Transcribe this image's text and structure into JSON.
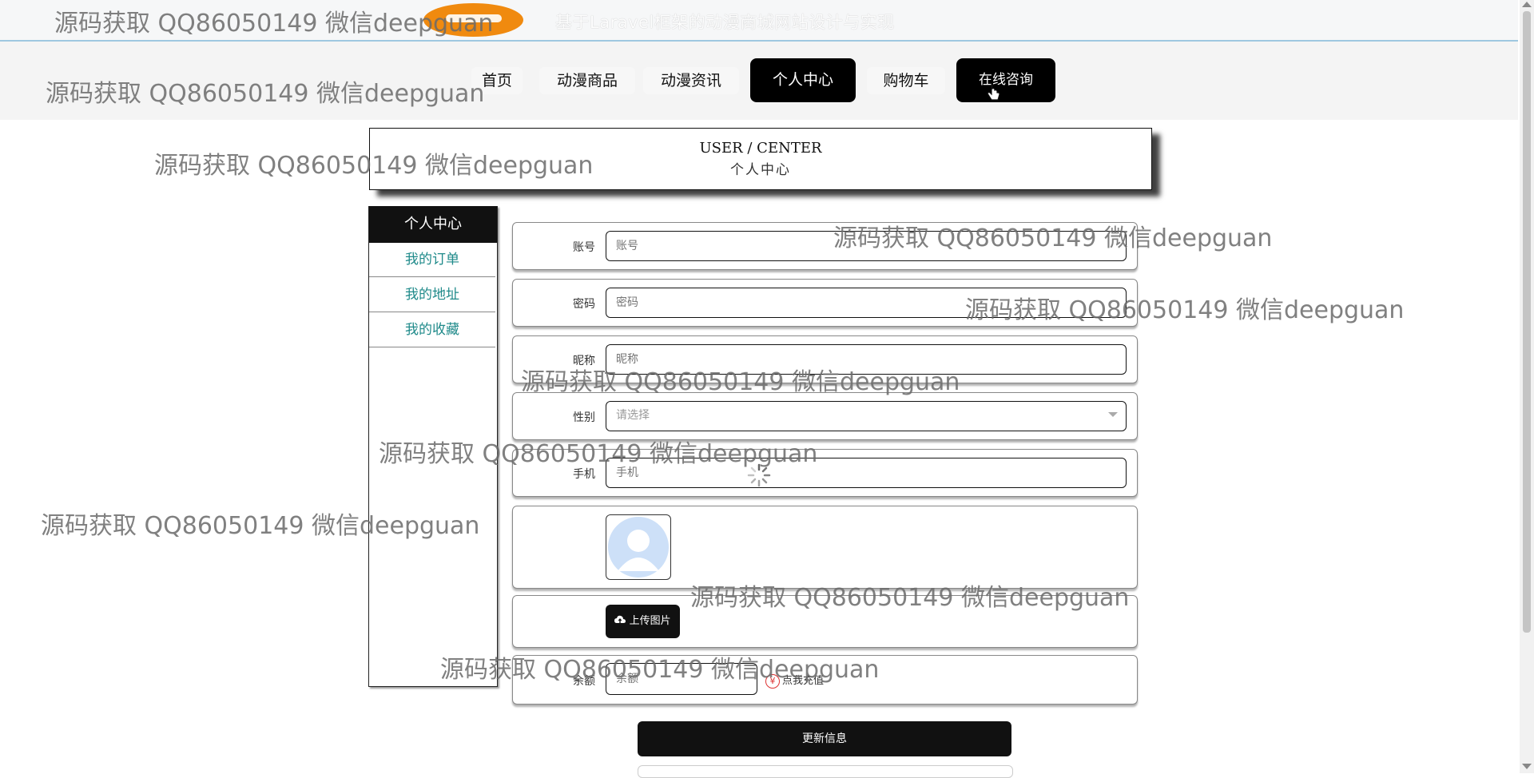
{
  "site": {
    "title": "基于Laravel框架的动漫商城网站设计与实现"
  },
  "nav": {
    "items": [
      "首页",
      "动漫商品",
      "动漫资讯",
      "个人中心",
      "购物车",
      "在线咨询"
    ],
    "active": "个人中心"
  },
  "header": {
    "en": "USER / CENTER",
    "zh": "个人中心"
  },
  "sidebar": {
    "title": "个人中心",
    "items": [
      "我的订单",
      "我的地址",
      "我的收藏"
    ]
  },
  "form": {
    "account": {
      "label": "账号",
      "placeholder": "账号"
    },
    "password": {
      "label": "密码",
      "placeholder": "密码"
    },
    "nickname": {
      "label": "昵称",
      "placeholder": "昵称"
    },
    "gender": {
      "label": "性别",
      "placeholder": "请选择"
    },
    "phone": {
      "label": "手机",
      "placeholder": "手机"
    },
    "avatar_icon": "user-avatar-icon",
    "upload_label": "上传图片",
    "upload_icon": "cloud-upload-icon",
    "balance": {
      "label": "余额",
      "placeholder": "余额"
    },
    "recharge_label": "点我充值",
    "recharge_icon": "yuan-icon",
    "submit_label": "更新信息"
  },
  "watermark": "源码获取 QQ86050149 微信deepguan",
  "colors": {
    "accent": "#111111",
    "link": "#1f8a8a",
    "logo": "#f08a0f"
  }
}
